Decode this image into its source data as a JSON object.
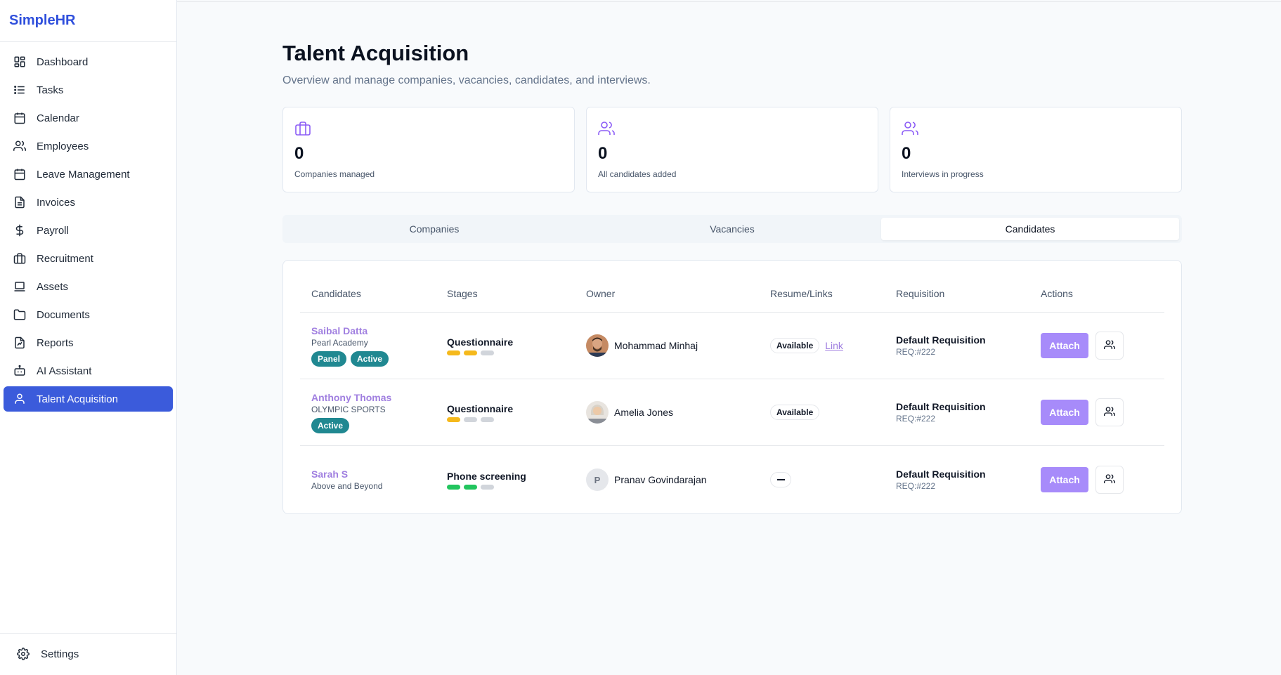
{
  "app": {
    "brand": "SimpleHR"
  },
  "sidebar": {
    "items": [
      {
        "label": "Dashboard",
        "icon": "dashboard-icon"
      },
      {
        "label": "Tasks",
        "icon": "list-icon"
      },
      {
        "label": "Calendar",
        "icon": "calendar-icon"
      },
      {
        "label": "Employees",
        "icon": "users-icon"
      },
      {
        "label": "Leave Management",
        "icon": "calendar-icon"
      },
      {
        "label": "Invoices",
        "icon": "file-text-icon"
      },
      {
        "label": "Payroll",
        "icon": "dollar-icon"
      },
      {
        "label": "Recruitment",
        "icon": "briefcase-icon"
      },
      {
        "label": "Assets",
        "icon": "laptop-icon"
      },
      {
        "label": "Documents",
        "icon": "folder-icon"
      },
      {
        "label": "Reports",
        "icon": "report-icon"
      },
      {
        "label": "AI Assistant",
        "icon": "bot-icon"
      },
      {
        "label": "Talent Acquisition",
        "icon": "user-icon",
        "active": true
      }
    ],
    "footer": {
      "label": "Settings",
      "icon": "gear-icon"
    }
  },
  "header": {
    "title": "Talent Acquisition",
    "subtitle": "Overview and manage companies, vacancies, candidates, and interviews."
  },
  "stats": [
    {
      "value": "0",
      "label": "Companies managed",
      "icon": "briefcase-icon"
    },
    {
      "value": "0",
      "label": "All candidates added",
      "icon": "users-icon"
    },
    {
      "value": "0",
      "label": "Interviews in progress",
      "icon": "users-icon"
    }
  ],
  "tabs": [
    {
      "label": "Companies"
    },
    {
      "label": "Vacancies"
    },
    {
      "label": "Candidates",
      "active": true
    }
  ],
  "table": {
    "columns": [
      "Candidates",
      "Stages",
      "Owner",
      "Resume/Links",
      "Requisition",
      "Actions"
    ],
    "rows": [
      {
        "name": "Saibal Datta",
        "company": "Pearl Academy",
        "badges": [
          "Panel",
          "Active"
        ],
        "stage": "Questionnaire",
        "stage_progress": [
          "yellow",
          "yellow",
          "grey"
        ],
        "owner": "Mohammad Minhaj",
        "owner_avatar": "photo",
        "resume": "Available",
        "link": "Link",
        "requisition": "Default Requisition",
        "req_id": "REQ:#222",
        "action_label": "Attach"
      },
      {
        "name": "Anthony Thomas",
        "company": "OLYMPIC SPORTS",
        "badges": [
          "Active"
        ],
        "stage": "Questionnaire",
        "stage_progress": [
          "yellow",
          "grey",
          "grey"
        ],
        "owner": "Amelia Jones",
        "owner_avatar": "photo",
        "resume": "Available",
        "link": "",
        "requisition": "Default Requisition",
        "req_id": "REQ:#222",
        "action_label": "Attach"
      },
      {
        "name": "Sarah S",
        "company": "Above and Beyond",
        "badges": [],
        "stage": "Phone screening",
        "stage_progress": [
          "green",
          "green",
          "grey"
        ],
        "owner": "Pranav Govindarajan",
        "owner_avatar": "P",
        "resume": "—",
        "link": "",
        "requisition": "Default Requisition",
        "req_id": "REQ:#222",
        "action_label": "Attach"
      }
    ]
  },
  "colors": {
    "brand": "#2f4fdc",
    "active_nav": "#3b5bdb",
    "accent_purple": "#a78bfa",
    "badge_teal": "#208891"
  }
}
